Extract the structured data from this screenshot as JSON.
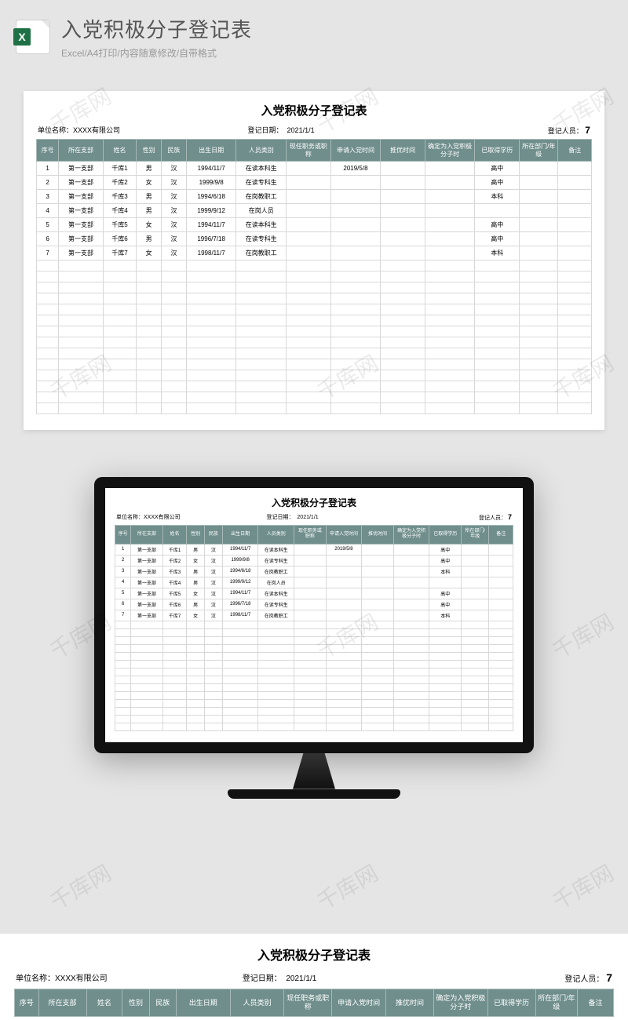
{
  "header": {
    "title": "入党积极分子登记表",
    "subtitle": "Excel/A4打印/内容随意修改/自带格式",
    "icon_letter": "X"
  },
  "sheet": {
    "title": "入党积极分子登记表",
    "meta": {
      "unit_label": "单位名称：",
      "unit_value": "XXXX有限公司",
      "date_label": "登记日期：",
      "date_value": "2021/1/1",
      "count_label": "登记人员：",
      "count_value": "7"
    },
    "columns": [
      "序号",
      "所在支部",
      "姓名",
      "性别",
      "民族",
      "出生日期",
      "人员类别",
      "现任职务或职称",
      "申请入党时间",
      "推优时间",
      "确定为入党积极分子时",
      "已取得学历",
      "所在部门/年级",
      "备注"
    ],
    "rows": [
      {
        "c": [
          "1",
          "第一支部",
          "千库1",
          "男",
          "汉",
          "1994/11/7",
          "在读本科生",
          "",
          "2019/5/8",
          "",
          "",
          "高中",
          "",
          ""
        ]
      },
      {
        "c": [
          "2",
          "第一支部",
          "千库2",
          "女",
          "汉",
          "1999/9/8",
          "在读专科生",
          "",
          "",
          "",
          "",
          "高中",
          "",
          ""
        ]
      },
      {
        "c": [
          "3",
          "第一支部",
          "千库3",
          "男",
          "汉",
          "1994/6/18",
          "在岗教职工",
          "",
          "",
          "",
          "",
          "本科",
          "",
          ""
        ]
      },
      {
        "c": [
          "4",
          "第一支部",
          "千库4",
          "男",
          "汉",
          "1999/9/12",
          "在岗人员",
          "",
          "",
          "",
          "",
          "",
          "",
          ""
        ]
      },
      {
        "c": [
          "5",
          "第一支部",
          "千库5",
          "女",
          "汉",
          "1994/11/7",
          "在读本科生",
          "",
          "",
          "",
          "",
          "高中",
          "",
          ""
        ]
      },
      {
        "c": [
          "6",
          "第一支部",
          "千库6",
          "男",
          "汉",
          "1996/7/18",
          "在读专科生",
          "",
          "",
          "",
          "",
          "高中",
          "",
          ""
        ]
      },
      {
        "c": [
          "7",
          "第一支部",
          "千库7",
          "女",
          "汉",
          "1998/11/7",
          "在岗教职工",
          "",
          "",
          "",
          "",
          "本科",
          "",
          ""
        ]
      }
    ],
    "empty_rows": 14
  },
  "watermark_text": "千库网",
  "colors": {
    "header_bg": "#6f8e8c"
  }
}
